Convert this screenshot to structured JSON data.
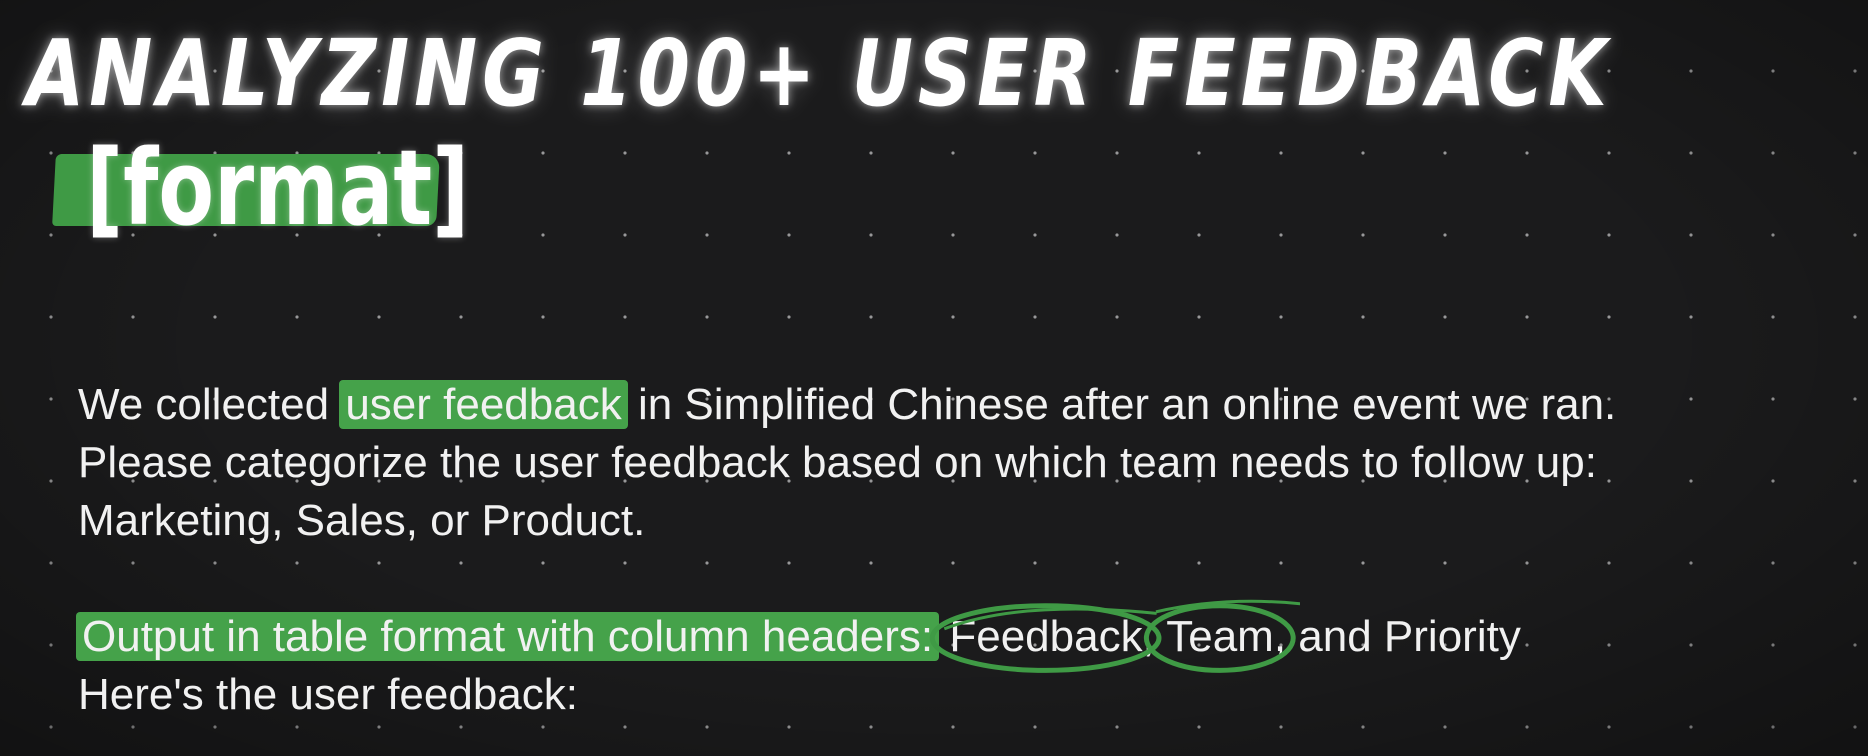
{
  "slide": {
    "title": "ANALYZING 100+ USER FEEDBACK",
    "subtitle": "[format]"
  },
  "prompt": {
    "line1_before": "We collected ",
    "line1_highlight": "user feedback",
    "line1_after": " in Simplified Chinese after an online event we ran.",
    "line2": "Please categorize the user feedback based on which team needs to follow up:",
    "line3": "Marketing, Sales, or Product.",
    "line4_highlight": "Output in table format with column headers:",
    "line4_feedback": "Feedback",
    "line4_sep1": ", ",
    "line4_team": "Team",
    "line4_after": ", and Priority",
    "line5": "Here's the user feedback:"
  },
  "colors": {
    "background": "#1b1b1c",
    "highlight": "#45a24a",
    "ring": "#3f9a45",
    "text": "#f1f1f1"
  }
}
